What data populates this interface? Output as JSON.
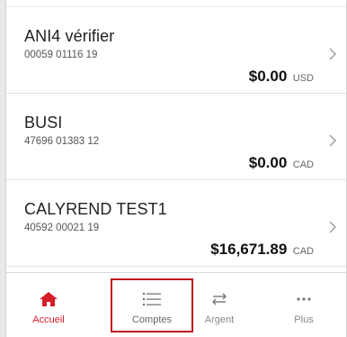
{
  "accounts": [
    {
      "name": "ANI4 vérifier",
      "number": "00059 01116 19",
      "amount": "$0.00",
      "currency": "USD"
    },
    {
      "name": "BUSI",
      "number": "47696 01383 12",
      "amount": "$0.00",
      "currency": "CAD"
    },
    {
      "name": "CALYREND TEST1",
      "number": "40592 00021 19",
      "amount": "$16,671.89",
      "currency": "CAD"
    }
  ],
  "bottom_nav": {
    "items": [
      {
        "label": "Accueil",
        "icon": "home-icon",
        "state": "active"
      },
      {
        "label": "Comptes",
        "icon": "list-icon",
        "state": "highlighted"
      },
      {
        "label": "Argent",
        "icon": "transfer-arrows-icon",
        "state": "normal"
      },
      {
        "label": "Plus",
        "icon": "more-dots-icon",
        "state": "normal"
      }
    ]
  },
  "colors": {
    "accent_red": "#d71e28",
    "highlight_border": "#c0181f",
    "text_primary": "#222222",
    "text_secondary": "#555555",
    "nav_inactive": "#888888"
  }
}
